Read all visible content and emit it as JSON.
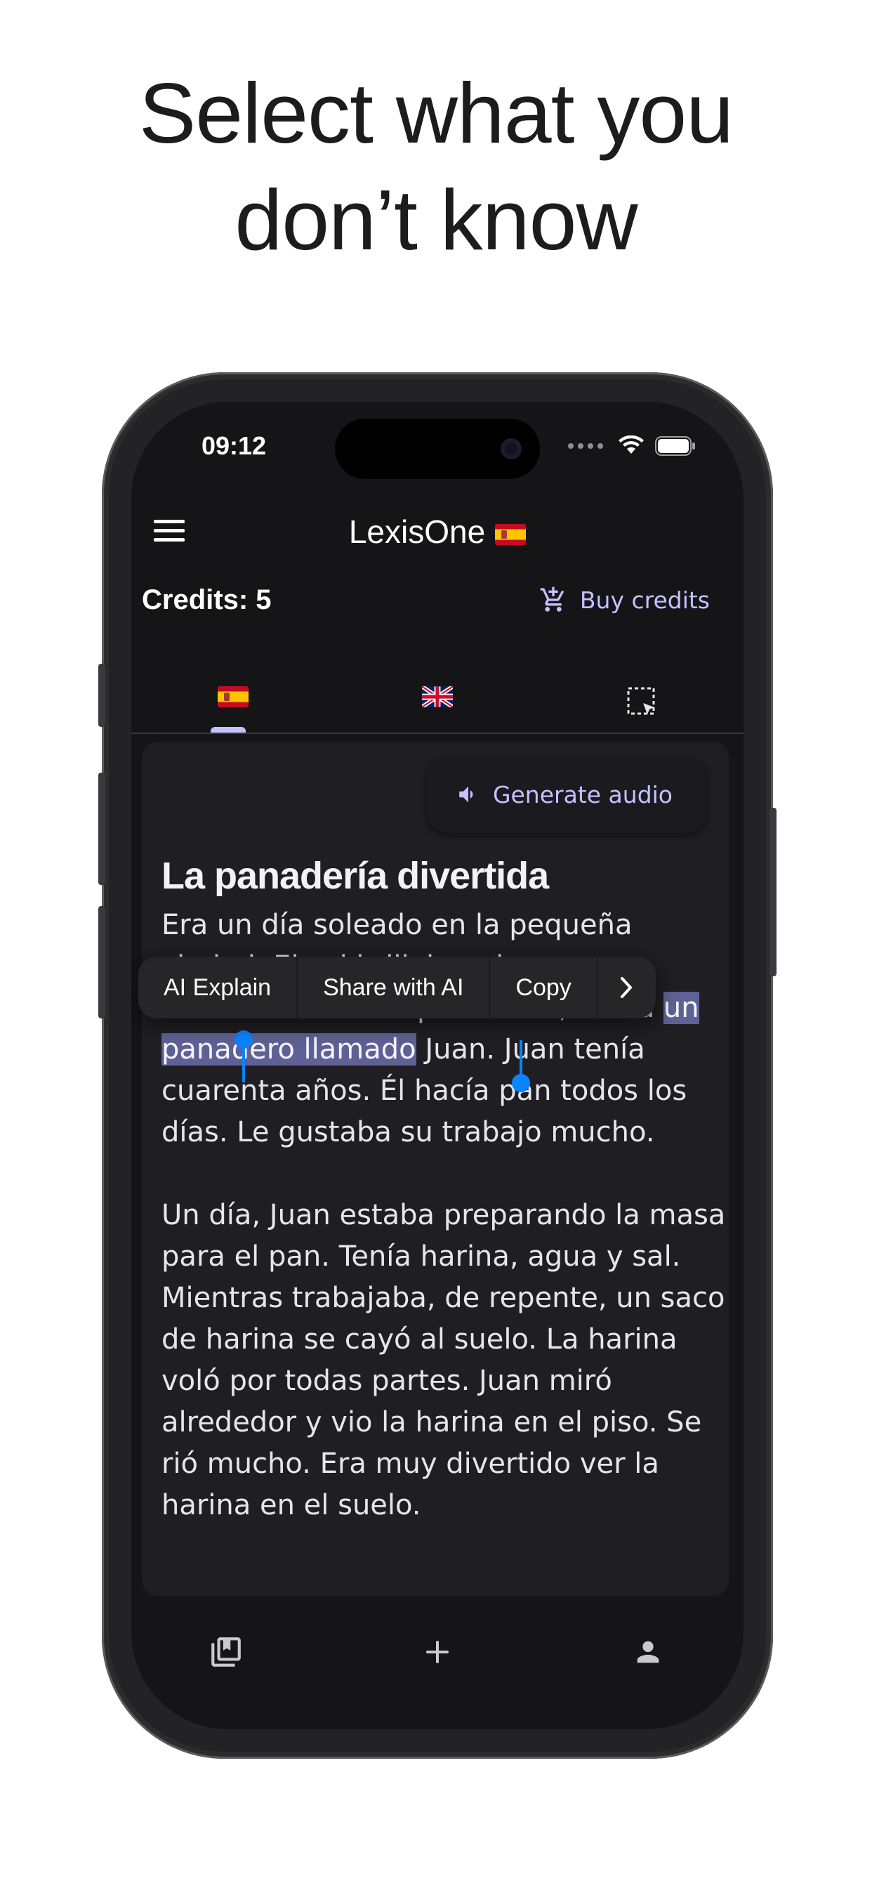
{
  "headline": {
    "line1": "Select what you",
    "line2": "don’t know"
  },
  "status_bar": {
    "time": "09:12"
  },
  "app": {
    "title": "LexisOne",
    "credits": "Credits: 5",
    "buy_credits": "Buy credits",
    "generate_audio": "Generate audio"
  },
  "tabs": [
    {
      "icon": "spain-flag-icon",
      "selected": true
    },
    {
      "icon": "uk-flag-icon",
      "selected": false
    },
    {
      "icon": "selection-icon",
      "selected": false
    }
  ],
  "story": {
    "title": "La panadería divertida",
    "para1_before": "Era un día soleado en la pequeña ciudad. El sol brillaba y las aves cantaban. En una panadería, había ",
    "para1_selected": "un panadero llamado",
    "para1_after": " Juan. Juan tenía cuarenta años. Él hacía pan todos los días. Le gustaba su trabajo mucho.",
    "para2": "Un día, Juan estaba preparando la masa para el pan. Tenía harina, agua y sal. Mientras trabajaba, de repente, un saco de harina se cayó al suelo. La harina voló por todas partes. Juan miró alrededor y vio la harina en el piso. Se rió mucho. Era muy divertido ver la harina en el suelo."
  },
  "context_menu": {
    "items": [
      "AI Explain",
      "Share with AI",
      "Copy"
    ],
    "more_icon": "chevron-right-icon"
  },
  "bottom_nav": [
    "library-icon",
    "add-icon",
    "profile-icon"
  ],
  "colors": {
    "accent": "#c7c0ff",
    "selection": "#5f6194",
    "handle": "#0a84ff",
    "background": "#151518"
  }
}
